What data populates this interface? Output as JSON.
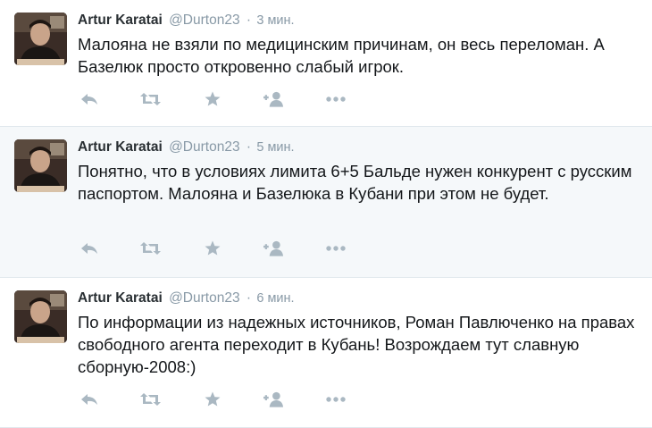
{
  "colors": {
    "name": "#292f33",
    "meta": "#8899a6",
    "text": "#14171a",
    "icon": "#aab8c2",
    "alt_background": "#f5f8fa",
    "divider": "#e1e8ed"
  },
  "tweets": [
    {
      "fullname": "Artur Karatai",
      "username": "@Durton23",
      "separator": "·",
      "time": "3 мин.",
      "text": "Малояна не взяли по медицинским причинам, он весь переломан. А Базелюк просто откровенно слабый игрок."
    },
    {
      "fullname": "Artur Karatai",
      "username": "@Durton23",
      "separator": "·",
      "time": "5 мин.",
      "text": "Понятно, что в условиях лимита 6+5 Бальде нужен конкурент с русским паспортом. Малояна и Базелюка в Кубани при этом не будет."
    },
    {
      "fullname": "Artur Karatai",
      "username": "@Durton23",
      "separator": "·",
      "time": "6 мин.",
      "text": "По информации из надежных источников, Роман Павлюченко на правах свободного агента переходит в Кубань! Возрождаем тут славную сборную-2008:)"
    }
  ],
  "action_icons": [
    "reply-icon",
    "retweet-icon",
    "favorite-icon",
    "follow-icon",
    "more-icon"
  ]
}
